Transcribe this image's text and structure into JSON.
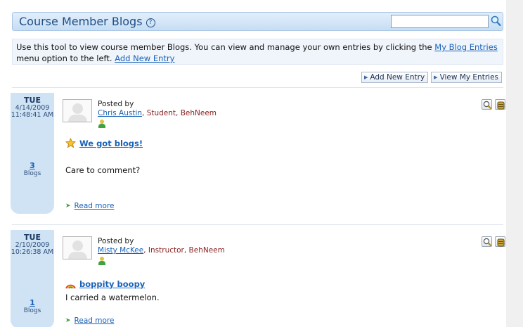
{
  "header": {
    "title": "Course Member Blogs",
    "help_glyph": "?",
    "search_value": ""
  },
  "intro": {
    "text_before": "Use this tool to view course member Blogs. You can view and manage your own entries by clicking the ",
    "my_blog_link": "My Blog Entries",
    "text_after": " menu option to the left. ",
    "add_link": "Add New Entry"
  },
  "actions": {
    "add_new": "Add New Entry",
    "view_mine": "View My Entries"
  },
  "entries": [
    {
      "dow": "TUE",
      "date": "4/14/2009",
      "time": "11:48:41 AM",
      "count": "3",
      "count_label": "Blogs",
      "posted_by": "Posted by",
      "author_name": "Chris Austin",
      "author_meta": ", Student, BehNeem",
      "title": "We got blogs!",
      "title_icon": "star-icon",
      "body": "Care to comment?",
      "read_more": "Read more"
    },
    {
      "dow": "TUE",
      "date": "2/10/2009",
      "time": "10:26:38 AM",
      "count": "1",
      "count_label": "Blogs",
      "posted_by": "Posted by",
      "author_name": "Misty McKee",
      "author_meta": ", Instructor, BehNeem",
      "title": "boppity boopy",
      "title_icon": "rainbow-icon",
      "body": "I carried a watermelon.",
      "read_more": "Read more"
    }
  ],
  "colors": {
    "accent": "#1a62b8",
    "header_bg": "#c6ddf4",
    "date_bg": "#cfe3f5",
    "author_meta": "#8a2222"
  }
}
